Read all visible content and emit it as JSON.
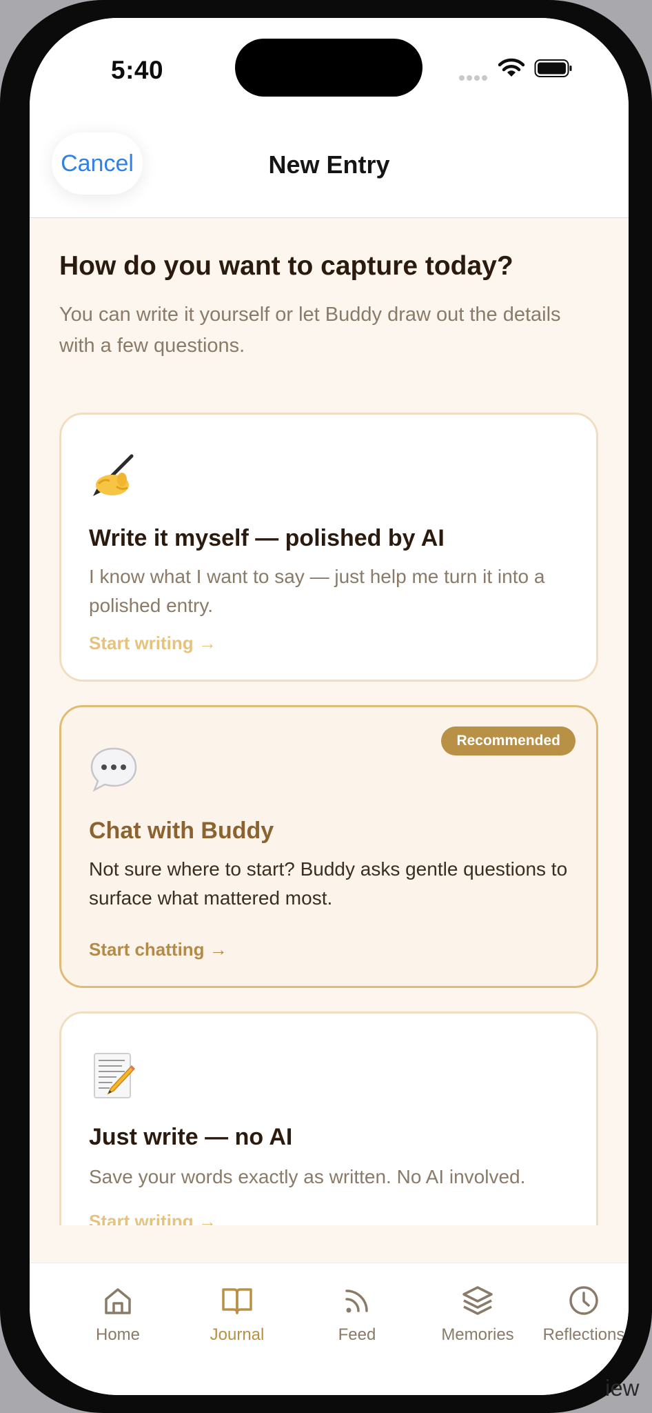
{
  "status_bar": {
    "time": "5:40"
  },
  "nav": {
    "cancel_label": "Cancel",
    "title": "New Entry"
  },
  "intro": {
    "heading": "How do you want to capture today?",
    "subtext": "You can write it yourself or let Buddy draw out the details with a few questions."
  },
  "options": [
    {
      "icon": "writing-hand-icon",
      "title": "Write it myself — polished by AI",
      "description": "I know what I want to say — just help me turn it into a polished entry.",
      "cta": "Start writing →"
    },
    {
      "icon": "speech-bubble-icon",
      "badge": "Recommended",
      "title": "Chat with Buddy",
      "description": "Not sure where to start? Buddy asks gentle questions to surface what mattered most.",
      "cta": "Start chatting →"
    },
    {
      "icon": "memo-icon",
      "title": "Just write — no AI",
      "description": "Save your words exactly as written. No AI involved.",
      "cta": "Start writing →"
    }
  ],
  "tab_bar": {
    "active": "Journal",
    "items": [
      {
        "label": "Home",
        "icon": "house-icon"
      },
      {
        "label": "Journal",
        "icon": "open-book-icon"
      },
      {
        "label": "Feed",
        "icon": "rss-icon"
      },
      {
        "label": "Memories",
        "icon": "layers-icon"
      },
      {
        "label": "Reflections",
        "icon": "clock-icon"
      }
    ]
  },
  "side_label": "iew",
  "colors": {
    "accent": "#b89046",
    "link_blue": "#2f80e8",
    "background": "#fdf6ee",
    "heading_text": "#2a1b0e",
    "muted_text": "#8a7a68"
  }
}
